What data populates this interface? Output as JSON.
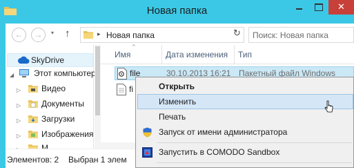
{
  "window": {
    "title": "Новая папка"
  },
  "titlebar": {
    "folder_icon": "folder-icon",
    "close_glyph": "✕"
  },
  "navbar": {
    "back_glyph": "←",
    "forward_glyph": "→",
    "recent_glyph": "▾",
    "up_glyph": "↑",
    "address_separator": "▸",
    "address": "Новая папка",
    "address_dropdown_glyph": "▾",
    "refresh_glyph": "↻",
    "search_placeholder": "Поиск: Новая папка"
  },
  "nav_pane": {
    "items": [
      {
        "label": "SkyDrive",
        "icon": "cloud-icon"
      },
      {
        "label": "Этот компьютер",
        "icon": "computer-icon"
      },
      {
        "label": "Видео",
        "icon": "video-folder-icon"
      },
      {
        "label": "Документы",
        "icon": "documents-folder-icon"
      },
      {
        "label": "Загрузки",
        "icon": "downloads-folder-icon"
      },
      {
        "label": "Изображения",
        "icon": "pictures-folder-icon"
      },
      {
        "label": "М",
        "icon": "music-folder-icon"
      }
    ],
    "expand_glyph": "▷"
  },
  "file_list": {
    "columns": [
      "Имя",
      "Дата изменения",
      "Тип"
    ],
    "sort_glyph": "^",
    "rows": [
      {
        "name": "file",
        "date": "30.10.2013 16:21",
        "type": "Пакетный файл Windows"
      },
      {
        "name": "fi",
        "date": "",
        "type": ""
      }
    ]
  },
  "status_bar": {
    "items_count": "Элементов: 2",
    "selected": "Выбран 1 элем"
  },
  "context_menu": {
    "items": [
      {
        "label": "Открыть",
        "bold": true
      },
      {
        "label": "Изменить",
        "hover": true
      },
      {
        "label": "Печать"
      },
      {
        "label": "Запуск от имени администратора",
        "icon": "uac-shield-icon"
      },
      {
        "label": "Запустить в COMODO Sandbox",
        "icon": "comodo-sandbox-icon"
      }
    ]
  },
  "colors": {
    "titlebar": "#3bc8e6",
    "close_button": "#c7403a",
    "selection": "#cbe8f6",
    "menu_hover": "#d5e7f7"
  }
}
